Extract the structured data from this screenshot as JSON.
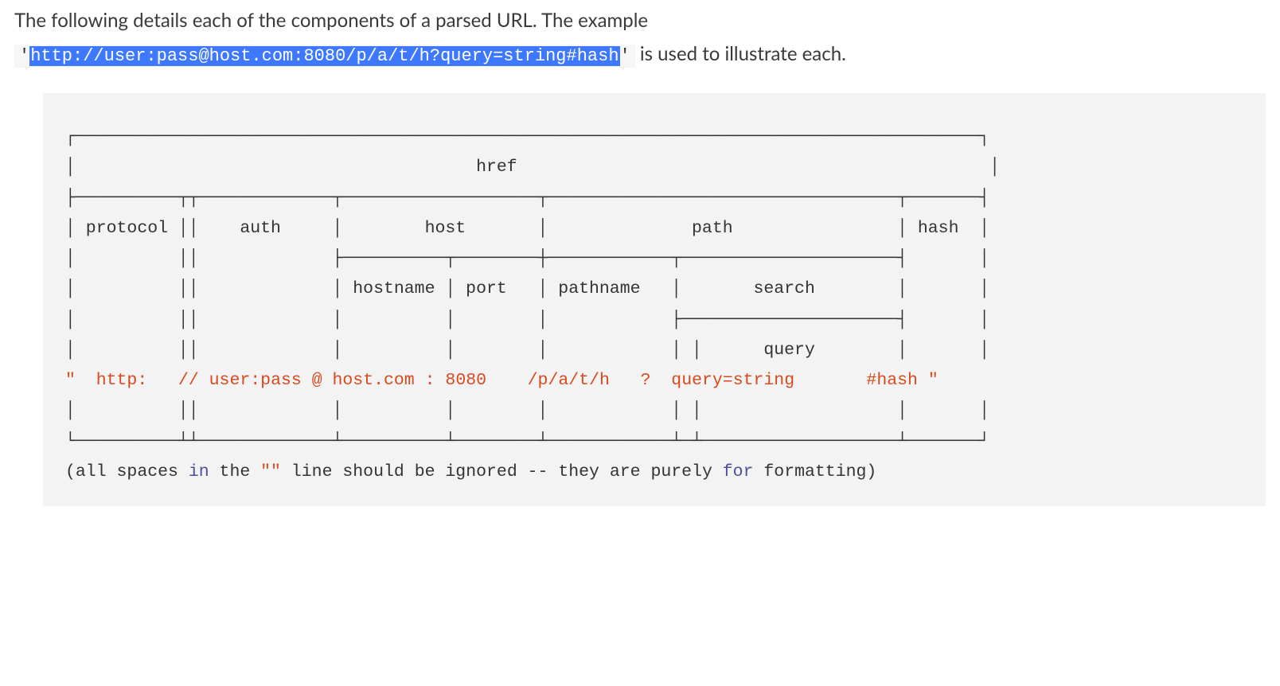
{
  "intro": {
    "line1": "The following details each of the components of a parsed URL. The example",
    "quote_open": "'",
    "url": "http://user:pass@host.com:8080/p/a/t/h?query=string#hash",
    "quote_close": "'",
    "after": " is used to illustrate each."
  },
  "diagram": {
    "r01": "┌────────────────────────────────────────────────────────────────────────────────────────┐",
    "r02": "│                                       href                                              │",
    "r03": "├──────────┬┬─────────────┬───────────────────┬──────────────────────────────────┬───────┤",
    "r04": "│ protocol ││    auth     │        host       │              path                │ hash  │",
    "r05": "│          ││             ├──────────┬────────┼────────────┬─────────────────────┤       │",
    "r06": "│          ││             │ hostname │ port   │ pathname   │       search        │       │",
    "r07": "│          ││             │          │        │            ├─────────────────────┤       │",
    "r08": "│          ││             │          │        │            │ │      query        │       │",
    "r10": "│          ││             │          │        │            │ │                   │       │",
    "r11": "└──────────┴┴─────────────┴──────────┴────────┴────────────┴─┴───────────────────┴───────┘",
    "url_line": {
      "q1": "\"",
      "protocol": "  http:   ",
      "slashes": "//",
      "auth": " user:pass ",
      "at": "@",
      "hostname": " host.com ",
      "colon": ":",
      "port": " 8080   ",
      "pathname": " /p/a/t/h   ",
      "qmark": "?",
      "query": "  query=string     ",
      "hash": "  #hash ",
      "q2": "\""
    }
  },
  "footnote": {
    "open": "(all spaces ",
    "kw1": "in",
    "mid1": " the ",
    "quotes": "\"\"",
    "mid2": " line should be ignored -- they are purely ",
    "kw2": "for",
    "end": " formatting)"
  }
}
